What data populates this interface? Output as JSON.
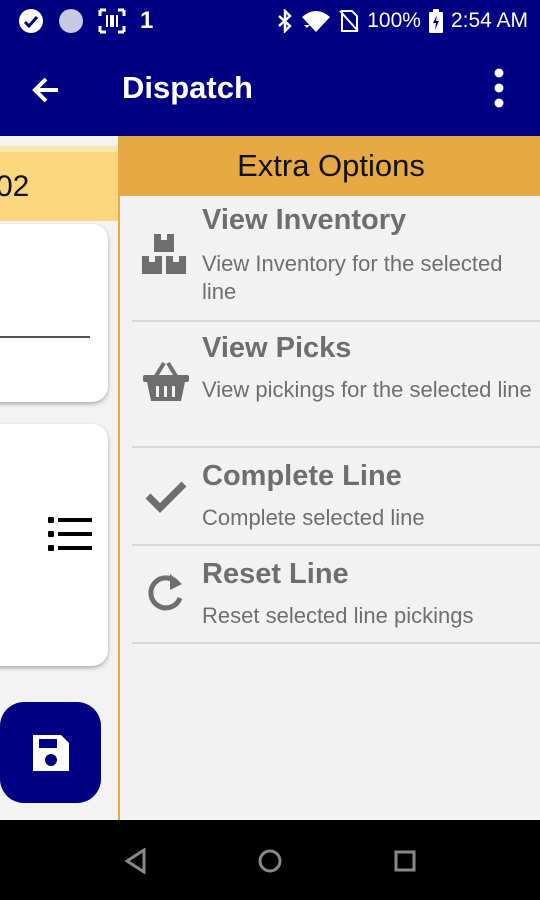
{
  "status_bar": {
    "notification_count": "1",
    "battery": "100%",
    "time": "2:54 AM"
  },
  "app_bar": {
    "title": "Dispatch"
  },
  "background_screen": {
    "header_text": "02"
  },
  "drawer": {
    "header": "Extra Options",
    "options": [
      {
        "title": "View Inventory",
        "description": "View Inventory for the selected line",
        "icon": "boxes-icon"
      },
      {
        "title": "View Picks",
        "description": "View pickings for the selected line",
        "icon": "basket-icon"
      },
      {
        "title": "Complete Line",
        "description": "Complete selected line",
        "icon": "check-icon"
      },
      {
        "title": "Reset Line",
        "description": "Reset selected line pickings",
        "icon": "redo-icon"
      }
    ]
  },
  "colors": {
    "primary": "#000084",
    "accent": "#e8a945",
    "header_light": "#fcd77f"
  }
}
